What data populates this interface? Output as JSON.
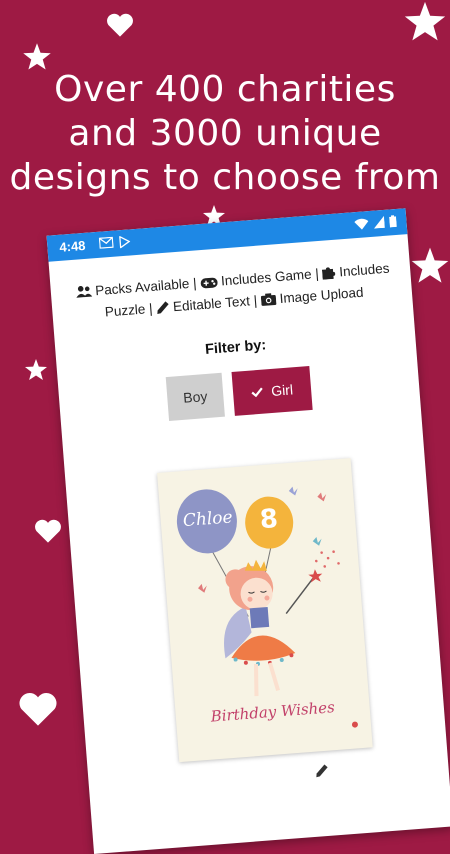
{
  "headline": {
    "lines": [
      "Over 400 charities",
      "and 3000 unique",
      "designs to choose from"
    ]
  },
  "status_bar": {
    "time": "4:48"
  },
  "features": {
    "packs": "Packs Available",
    "game": "Includes Game",
    "puzzle": "Includes Puzzle",
    "editable": "Editable Text",
    "image": "Image Upload",
    "separator": "|"
  },
  "filter": {
    "label": "Filter by:",
    "options": [
      "Boy",
      "Girl"
    ],
    "selected": "Girl"
  },
  "card": {
    "name_balloon": "Chloe",
    "age_balloon": "8",
    "caption": "Birthday Wishes"
  },
  "colors": {
    "background": "#9e1a44",
    "status_bar": "#1e88e5",
    "selected_filter": "#9e1a44",
    "unselected_filter": "#cfcfcf"
  }
}
